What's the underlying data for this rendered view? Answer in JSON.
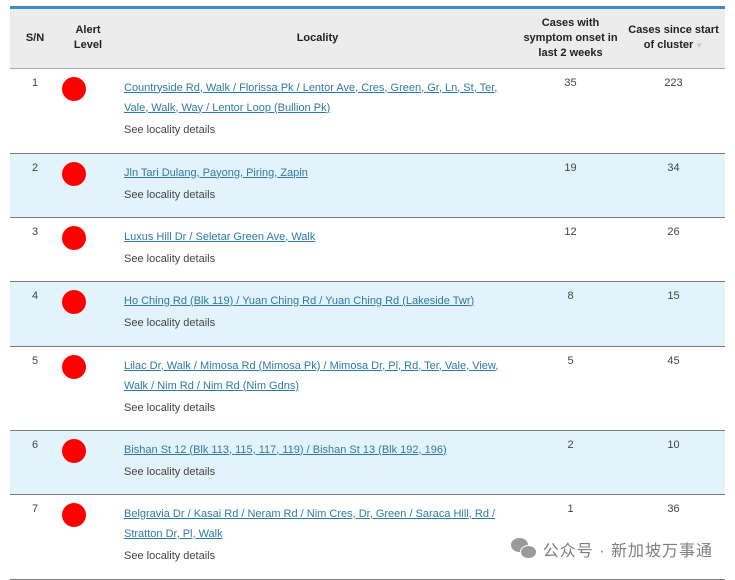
{
  "header": {
    "sn": "S/N",
    "alert_level": "Alert Level",
    "locality": "Locality",
    "cases_recent": "Cases with symptom onset in last 2 weeks",
    "cases_total": "Cases since start of cluster",
    "sort_icon": "sort-arrow-down"
  },
  "rows": [
    {
      "sn": "1",
      "alert": "red",
      "locality": "Countryside Rd, Walk / Florissa Pk / Lentor Ave, Cres, Green, Gr, Ln, St, Ter, Vale, Walk, Way / Lentor Loop (Bullion Pk)",
      "details": "See locality details",
      "recent": "35",
      "total": "223"
    },
    {
      "sn": "2",
      "alert": "red",
      "locality": "Jln Tari Dulang, Payong, Piring, Zapin",
      "details": "See locality details",
      "recent": "19",
      "total": "34"
    },
    {
      "sn": "3",
      "alert": "red",
      "locality": "Luxus Hill Dr / Seletar Green Ave, Walk",
      "details": "See locality details",
      "recent": "12",
      "total": "26"
    },
    {
      "sn": "4",
      "alert": "red",
      "locality": "Ho Ching Rd (Blk 119) / Yuan Ching Rd / Yuan Ching Rd (Lakeside Twr)",
      "details": "See locality details",
      "recent": "8",
      "total": "15"
    },
    {
      "sn": "5",
      "alert": "red",
      "locality": "Lilac Dr, Walk / Mimosa Rd (Mimosa Pk) / Mimosa Dr, Pl, Rd, Ter, Vale, View, Walk / Nim Rd / Nim Rd (Nim Gdns)",
      "details": "See locality details",
      "recent": "5",
      "total": "45"
    },
    {
      "sn": "6",
      "alert": "red",
      "locality": "Bishan St 12 (Blk 113, 115, 117, 119) / Bishan St 13 (Blk 192, 196)",
      "details": "See locality details",
      "recent": "2",
      "total": "10"
    },
    {
      "sn": "7",
      "alert": "red",
      "locality": "Belgravia Dr / Kasai Rd / Neram Rd / Nim Cres, Dr, Green / Saraca Hill, Rd / Stratton Dr, Pl, Walk",
      "details": "See locality details",
      "recent": "1",
      "total": "36"
    }
  ],
  "colors": {
    "alert_red": "#ff0000",
    "link": "#2f7aa2",
    "alt_row": "#e3f3fb",
    "accent": "#3b8dc4"
  },
  "watermark": {
    "text": "公众号 · 新加坡万事通",
    "icon": "wechat-icon"
  }
}
